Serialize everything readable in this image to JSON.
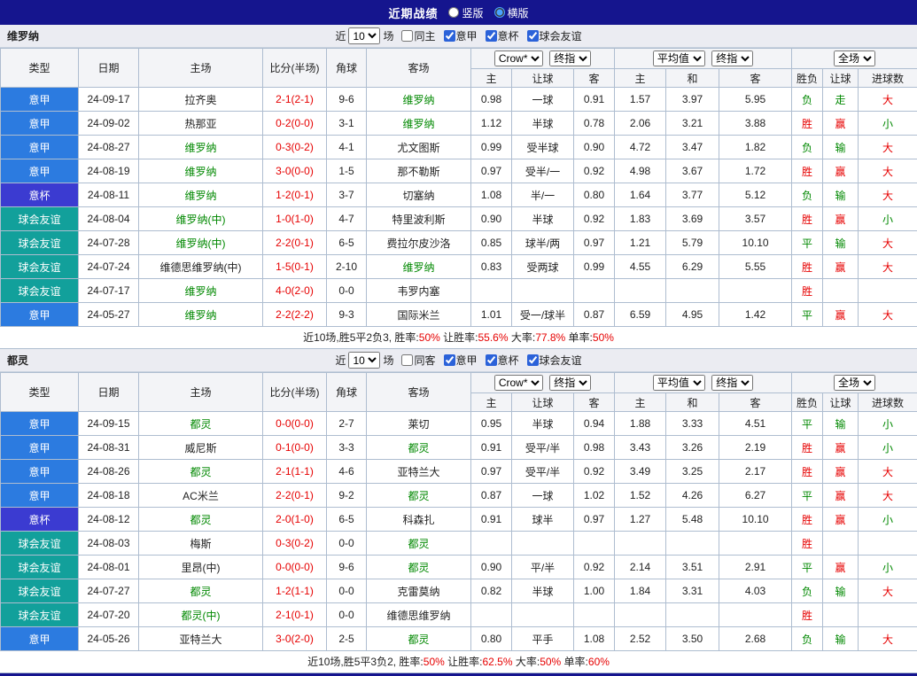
{
  "topbar": {
    "title": "近期战绩",
    "radios": [
      {
        "label": "竖版",
        "checked": false
      },
      {
        "label": "横版",
        "checked": true
      }
    ]
  },
  "filter": {
    "near": "近",
    "count": "10",
    "suffix": "场",
    "leagues": [
      "意甲",
      "意杯",
      "球会友谊"
    ]
  },
  "table_header": {
    "left_cols": [
      "类型",
      "日期",
      "主场",
      "比分(半场)",
      "角球",
      "客场"
    ],
    "odds_select": "Crow*",
    "odds_final_select": "终指",
    "odds_cols": [
      "主",
      "让球",
      "客"
    ],
    "avg_select": "平均值",
    "avg_final_select": "终指",
    "avg_cols": [
      "主",
      "和",
      "客"
    ],
    "full_select": "全场",
    "full_cols": [
      "胜负",
      "让球",
      "进球数"
    ]
  },
  "colors": {
    "topbar_navy": "#15158e",
    "serie_a_blue": "#2c7be0",
    "italy_cup_indigo": "#3b3bd1",
    "friendly_teal": "#12a09b",
    "focus_team_green": "#008800",
    "win_red": "#e60000",
    "loss_green": "#008800"
  },
  "sections": [
    {
      "team": "维罗纳",
      "same_label": "同主",
      "same_checked": false,
      "league_checked": [
        true,
        true,
        true
      ],
      "rows": [
        {
          "type": "意甲",
          "tc": "a",
          "date": "24-09-17",
          "home": "拉齐奥",
          "hf": false,
          "score": "2-1(2-1)",
          "corner": "9-6",
          "away": "维罗纳",
          "af": true,
          "o1": "0.98",
          "h": "一球",
          "o2": "0.91",
          "a1": "1.57",
          "a2": "3.97",
          "a3": "5.95",
          "res": "负",
          "resc": "g",
          "cov": "走",
          "covc": "g",
          "big": "大",
          "bigc": "r"
        },
        {
          "type": "意甲",
          "tc": "a",
          "date": "24-09-02",
          "home": "热那亚",
          "hf": false,
          "score": "0-2(0-0)",
          "corner": "3-1",
          "away": "维罗纳",
          "af": true,
          "o1": "1.12",
          "h": "半球",
          "o2": "0.78",
          "a1": "2.06",
          "a2": "3.21",
          "a3": "3.88",
          "res": "胜",
          "resc": "r",
          "cov": "赢",
          "covc": "r",
          "big": "小",
          "bigc": "g"
        },
        {
          "type": "意甲",
          "tc": "a",
          "date": "24-08-27",
          "home": "维罗纳",
          "hf": true,
          "score": "0-3(0-2)",
          "corner": "4-1",
          "away": "尤文图斯",
          "af": false,
          "o1": "0.99",
          "h": "受半球",
          "o2": "0.90",
          "a1": "4.72",
          "a2": "3.47",
          "a3": "1.82",
          "res": "负",
          "resc": "g",
          "cov": "输",
          "covc": "g",
          "big": "大",
          "bigc": "r"
        },
        {
          "type": "意甲",
          "tc": "a",
          "date": "24-08-19",
          "home": "维罗纳",
          "hf": true,
          "score": "3-0(0-0)",
          "corner": "1-5",
          "away": "那不勒斯",
          "af": false,
          "o1": "0.97",
          "h": "受半/一",
          "o2": "0.92",
          "a1": "4.98",
          "a2": "3.67",
          "a3": "1.72",
          "res": "胜",
          "resc": "r",
          "cov": "赢",
          "covc": "r",
          "big": "大",
          "bigc": "r"
        },
        {
          "type": "意杯",
          "tc": "b",
          "date": "24-08-11",
          "home": "维罗纳",
          "hf": true,
          "score": "1-2(0-1)",
          "corner": "3-7",
          "away": "切塞纳",
          "af": false,
          "o1": "1.08",
          "h": "半/一",
          "o2": "0.80",
          "a1": "1.64",
          "a2": "3.77",
          "a3": "5.12",
          "res": "负",
          "resc": "g",
          "cov": "输",
          "covc": "g",
          "big": "大",
          "bigc": "r"
        },
        {
          "type": "球会友谊",
          "tc": "f",
          "date": "24-08-04",
          "home": "维罗纳(中)",
          "hf": true,
          "score": "1-0(1-0)",
          "corner": "4-7",
          "away": "特里波利斯",
          "af": false,
          "o1": "0.90",
          "h": "半球",
          "o2": "0.92",
          "a1": "1.83",
          "a2": "3.69",
          "a3": "3.57",
          "res": "胜",
          "resc": "r",
          "cov": "赢",
          "covc": "r",
          "big": "小",
          "bigc": "g"
        },
        {
          "type": "球会友谊",
          "tc": "f",
          "date": "24-07-28",
          "home": "维罗纳(中)",
          "hf": true,
          "score": "2-2(0-1)",
          "corner": "6-5",
          "away": "费拉尔皮沙洛",
          "af": false,
          "o1": "0.85",
          "h": "球半/两",
          "o2": "0.97",
          "a1": "1.21",
          "a2": "5.79",
          "a3": "10.10",
          "res": "平",
          "resc": "g",
          "cov": "输",
          "covc": "g",
          "big": "大",
          "bigc": "r"
        },
        {
          "type": "球会友谊",
          "tc": "f",
          "date": "24-07-24",
          "home": "维德思维罗纳(中)",
          "hf": false,
          "score": "1-5(0-1)",
          "corner": "2-10",
          "away": "维罗纳",
          "af": true,
          "o1": "0.83",
          "h": "受两球",
          "o2": "0.99",
          "a1": "4.55",
          "a2": "6.29",
          "a3": "5.55",
          "res": "胜",
          "resc": "r",
          "cov": "赢",
          "covc": "r",
          "big": "大",
          "bigc": "r"
        },
        {
          "type": "球会友谊",
          "tc": "f",
          "date": "24-07-17",
          "home": "维罗纳",
          "hf": true,
          "score": "4-0(2-0)",
          "corner": "0-0",
          "away": "韦罗内塞",
          "af": false,
          "o1": "",
          "h": "",
          "o2": "",
          "a1": "",
          "a2": "",
          "a3": "",
          "res": "胜",
          "resc": "r",
          "cov": "",
          "covc": "",
          "big": "",
          "bigc": ""
        },
        {
          "type": "意甲",
          "tc": "a",
          "date": "24-05-27",
          "home": "维罗纳",
          "hf": true,
          "score": "2-2(2-2)",
          "corner": "9-3",
          "away": "国际米兰",
          "af": false,
          "o1": "1.01",
          "h": "受一/球半",
          "o2": "0.87",
          "a1": "6.59",
          "a2": "4.95",
          "a3": "1.42",
          "res": "平",
          "resc": "g",
          "cov": "赢",
          "covc": "r",
          "big": "大",
          "bigc": "r"
        }
      ],
      "summary": [
        {
          "t": "近10场,胜5平2负3, 胜率:",
          "c": "dark"
        },
        {
          "t": "50%",
          "c": "red"
        },
        {
          "t": " 让胜率:",
          "c": "dark"
        },
        {
          "t": "55.6%",
          "c": "red"
        },
        {
          "t": " 大率:",
          "c": "dark"
        },
        {
          "t": "77.8%",
          "c": "red"
        },
        {
          "t": " 单率:",
          "c": "dark"
        },
        {
          "t": "50%",
          "c": "red"
        }
      ]
    },
    {
      "team": "都灵",
      "same_label": "同客",
      "same_checked": false,
      "league_checked": [
        true,
        true,
        true
      ],
      "rows": [
        {
          "type": "意甲",
          "tc": "a",
          "date": "24-09-15",
          "home": "都灵",
          "hf": true,
          "score": "0-0(0-0)",
          "corner": "2-7",
          "away": "莱切",
          "af": false,
          "o1": "0.95",
          "h": "半球",
          "o2": "0.94",
          "a1": "1.88",
          "a2": "3.33",
          "a3": "4.51",
          "res": "平",
          "resc": "g",
          "cov": "输",
          "covc": "g",
          "big": "小",
          "bigc": "g"
        },
        {
          "type": "意甲",
          "tc": "a",
          "date": "24-08-31",
          "home": "威尼斯",
          "hf": false,
          "score": "0-1(0-0)",
          "corner": "3-3",
          "away": "都灵",
          "af": true,
          "o1": "0.91",
          "h": "受平/半",
          "o2": "0.98",
          "a1": "3.43",
          "a2": "3.26",
          "a3": "2.19",
          "res": "胜",
          "resc": "r",
          "cov": "赢",
          "covc": "r",
          "big": "小",
          "bigc": "g"
        },
        {
          "type": "意甲",
          "tc": "a",
          "date": "24-08-26",
          "home": "都灵",
          "hf": true,
          "score": "2-1(1-1)",
          "corner": "4-6",
          "away": "亚特兰大",
          "af": false,
          "o1": "0.97",
          "h": "受平/半",
          "o2": "0.92",
          "a1": "3.49",
          "a2": "3.25",
          "a3": "2.17",
          "res": "胜",
          "resc": "r",
          "cov": "赢",
          "covc": "r",
          "big": "大",
          "bigc": "r"
        },
        {
          "type": "意甲",
          "tc": "a",
          "date": "24-08-18",
          "home": "AC米兰",
          "hf": false,
          "score": "2-2(0-1)",
          "corner": "9-2",
          "away": "都灵",
          "af": true,
          "o1": "0.87",
          "h": "一球",
          "o2": "1.02",
          "a1": "1.52",
          "a2": "4.26",
          "a3": "6.27",
          "res": "平",
          "resc": "g",
          "cov": "赢",
          "covc": "r",
          "big": "大",
          "bigc": "r"
        },
        {
          "type": "意杯",
          "tc": "b",
          "date": "24-08-12",
          "home": "都灵",
          "hf": true,
          "score": "2-0(1-0)",
          "corner": "6-5",
          "away": "科森扎",
          "af": false,
          "o1": "0.91",
          "h": "球半",
          "o2": "0.97",
          "a1": "1.27",
          "a2": "5.48",
          "a3": "10.10",
          "res": "胜",
          "resc": "r",
          "cov": "赢",
          "covc": "r",
          "big": "小",
          "bigc": "g"
        },
        {
          "type": "球会友谊",
          "tc": "f",
          "date": "24-08-03",
          "home": "梅斯",
          "hf": false,
          "score": "0-3(0-2)",
          "corner": "0-0",
          "away": "都灵",
          "af": true,
          "o1": "",
          "h": "",
          "o2": "",
          "a1": "",
          "a2": "",
          "a3": "",
          "res": "胜",
          "resc": "r",
          "cov": "",
          "covc": "",
          "big": "",
          "bigc": ""
        },
        {
          "type": "球会友谊",
          "tc": "f",
          "date": "24-08-01",
          "home": "里昂(中)",
          "hf": false,
          "score": "0-0(0-0)",
          "corner": "9-6",
          "away": "都灵",
          "af": true,
          "o1": "0.90",
          "h": "平/半",
          "o2": "0.92",
          "a1": "2.14",
          "a2": "3.51",
          "a3": "2.91",
          "res": "平",
          "resc": "g",
          "cov": "赢",
          "covc": "r",
          "big": "小",
          "bigc": "g"
        },
        {
          "type": "球会友谊",
          "tc": "f",
          "date": "24-07-27",
          "home": "都灵",
          "hf": true,
          "score": "1-2(1-1)",
          "corner": "0-0",
          "away": "克雷莫纳",
          "af": false,
          "o1": "0.82",
          "h": "半球",
          "o2": "1.00",
          "a1": "1.84",
          "a2": "3.31",
          "a3": "4.03",
          "res": "负",
          "resc": "g",
          "cov": "输",
          "covc": "g",
          "big": "大",
          "bigc": "r"
        },
        {
          "type": "球会友谊",
          "tc": "f",
          "date": "24-07-20",
          "home": "都灵(中)",
          "hf": true,
          "score": "2-1(0-1)",
          "corner": "0-0",
          "away": "维德思维罗纳",
          "af": false,
          "o1": "",
          "h": "",
          "o2": "",
          "a1": "",
          "a2": "",
          "a3": "",
          "res": "胜",
          "resc": "r",
          "cov": "",
          "covc": "",
          "big": "",
          "bigc": ""
        },
        {
          "type": "意甲",
          "tc": "a",
          "date": "24-05-26",
          "home": "亚特兰大",
          "hf": false,
          "score": "3-0(2-0)",
          "corner": "2-5",
          "away": "都灵",
          "af": true,
          "o1": "0.80",
          "h": "平手",
          "o2": "1.08",
          "a1": "2.52",
          "a2": "3.50",
          "a3": "2.68",
          "res": "负",
          "resc": "g",
          "cov": "输",
          "covc": "g",
          "big": "大",
          "bigc": "r"
        }
      ],
      "summary": [
        {
          "t": "近10场,胜5平3负2, 胜率:",
          "c": "dark"
        },
        {
          "t": "50%",
          "c": "red"
        },
        {
          "t": " 让胜率:",
          "c": "dark"
        },
        {
          "t": "62.5%",
          "c": "red"
        },
        {
          "t": " 大率:",
          "c": "dark"
        },
        {
          "t": "50%",
          "c": "red"
        },
        {
          "t": " 单率:",
          "c": "dark"
        },
        {
          "t": "60%",
          "c": "red"
        }
      ]
    }
  ]
}
